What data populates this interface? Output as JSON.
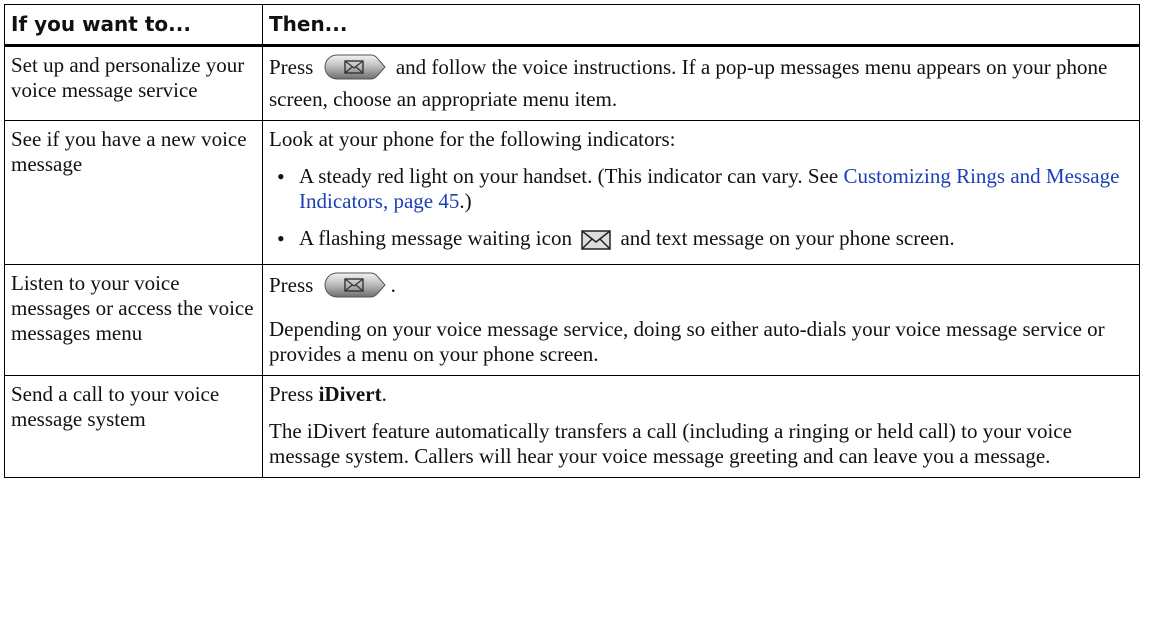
{
  "headers": {
    "left": "If you want to...",
    "right": "Then..."
  },
  "rows": [
    {
      "task": "Set up and personalize your voice message service",
      "press": "Press",
      "rest": "and follow the voice instructions. If a pop-up messages menu appears on your phone screen, choose an appropriate menu item."
    },
    {
      "task": "See if you have a new voice message",
      "intro": "Look at your phone for the following indicators:",
      "bullet1_a": "A steady red light on your handset. (This indicator can vary. See ",
      "bullet1_link": "Customizing Rings and Message Indicators, page 45",
      "bullet1_b": ".)",
      "bullet2_a": "A flashing message waiting icon",
      "bullet2_b": "and text message on your phone screen."
    },
    {
      "task": "Listen to your voice messages or access the voice messages menu",
      "press": "Press",
      "after": ".",
      "para2": "Depending on your voice message service, doing so either auto-dials your voice message service or provides a menu on your phone screen."
    },
    {
      "task": "Send a call to your voice message system",
      "press": "Press",
      "softkey": "iDivert",
      "period": ".",
      "para2": "The iDivert feature automatically transfers a call (including a ringing or held call) to your voice message system. Callers will hear your voice message greeting and can leave you a message."
    }
  ],
  "icons": {
    "messages_button": "messages-button-icon",
    "message_waiting": "envelope-icon"
  },
  "colors": {
    "link": "#1a3fb8",
    "border": "#000000"
  }
}
